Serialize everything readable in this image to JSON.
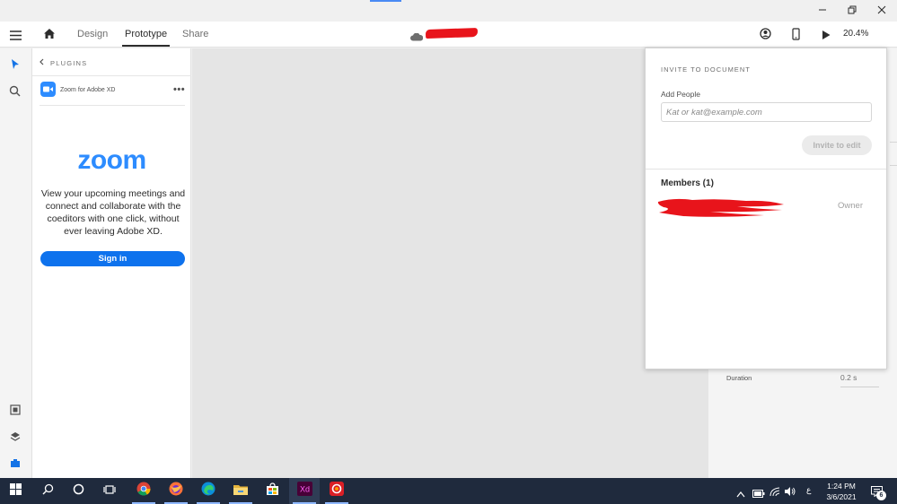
{
  "header": {
    "tabs": [
      {
        "label": "Design",
        "active": false
      },
      {
        "label": "Prototype",
        "active": true
      },
      {
        "label": "Share",
        "active": false
      }
    ],
    "zoom_level": "20.4%"
  },
  "plugins_panel": {
    "heading": "PLUGINS",
    "plugin_name": "Zoom for Adobe XD",
    "more_label": "•••",
    "logo_text": "zoom",
    "description": "View your upcoming meetings and connect and collaborate with the coeditors with one click, without ever leaving Adobe XD.",
    "sign_in_label": "Sign in"
  },
  "invite_popover": {
    "title": "INVITE TO DOCUMENT",
    "add_people_label": "Add People",
    "email_placeholder": "Kat or kat@example.com",
    "invite_button_label": "Invite to edit",
    "members_heading": "Members (1)",
    "members": [
      {
        "role": "Owner"
      }
    ]
  },
  "properties_panel": {
    "duration_label": "Duration",
    "duration_value": "0.2 s"
  },
  "taskbar": {
    "time": "1:24 PM",
    "date": "3/6/2021",
    "language": "ع",
    "notification_count": "6"
  },
  "colors": {
    "accent": "#2d8cff",
    "sign_in_button": "#0e72ed",
    "taskbar": "#1f2a3d",
    "canvas": "#e5e5e5"
  },
  "icons": [
    "hamburger-menu-icon",
    "home-icon",
    "cloud-icon",
    "user-icon",
    "mobile-device-icon",
    "play-icon",
    "select-arrow-icon",
    "search-icon",
    "assets-icon",
    "layers-icon",
    "plugins-icon",
    "chevron-left-icon",
    "zoom-camera-icon",
    "minimize-icon",
    "restore-icon",
    "close-icon",
    "windows-start-icon",
    "cortana-search-icon",
    "cortana-circle-icon",
    "task-view-icon",
    "chrome-icon",
    "firefox-icon",
    "edge-icon",
    "file-explorer-icon",
    "store-icon",
    "adobe-xd-icon",
    "creative-cloud-icon",
    "chevron-up-icon",
    "battery-icon",
    "wifi-icon",
    "volume-icon",
    "notifications-icon"
  ]
}
